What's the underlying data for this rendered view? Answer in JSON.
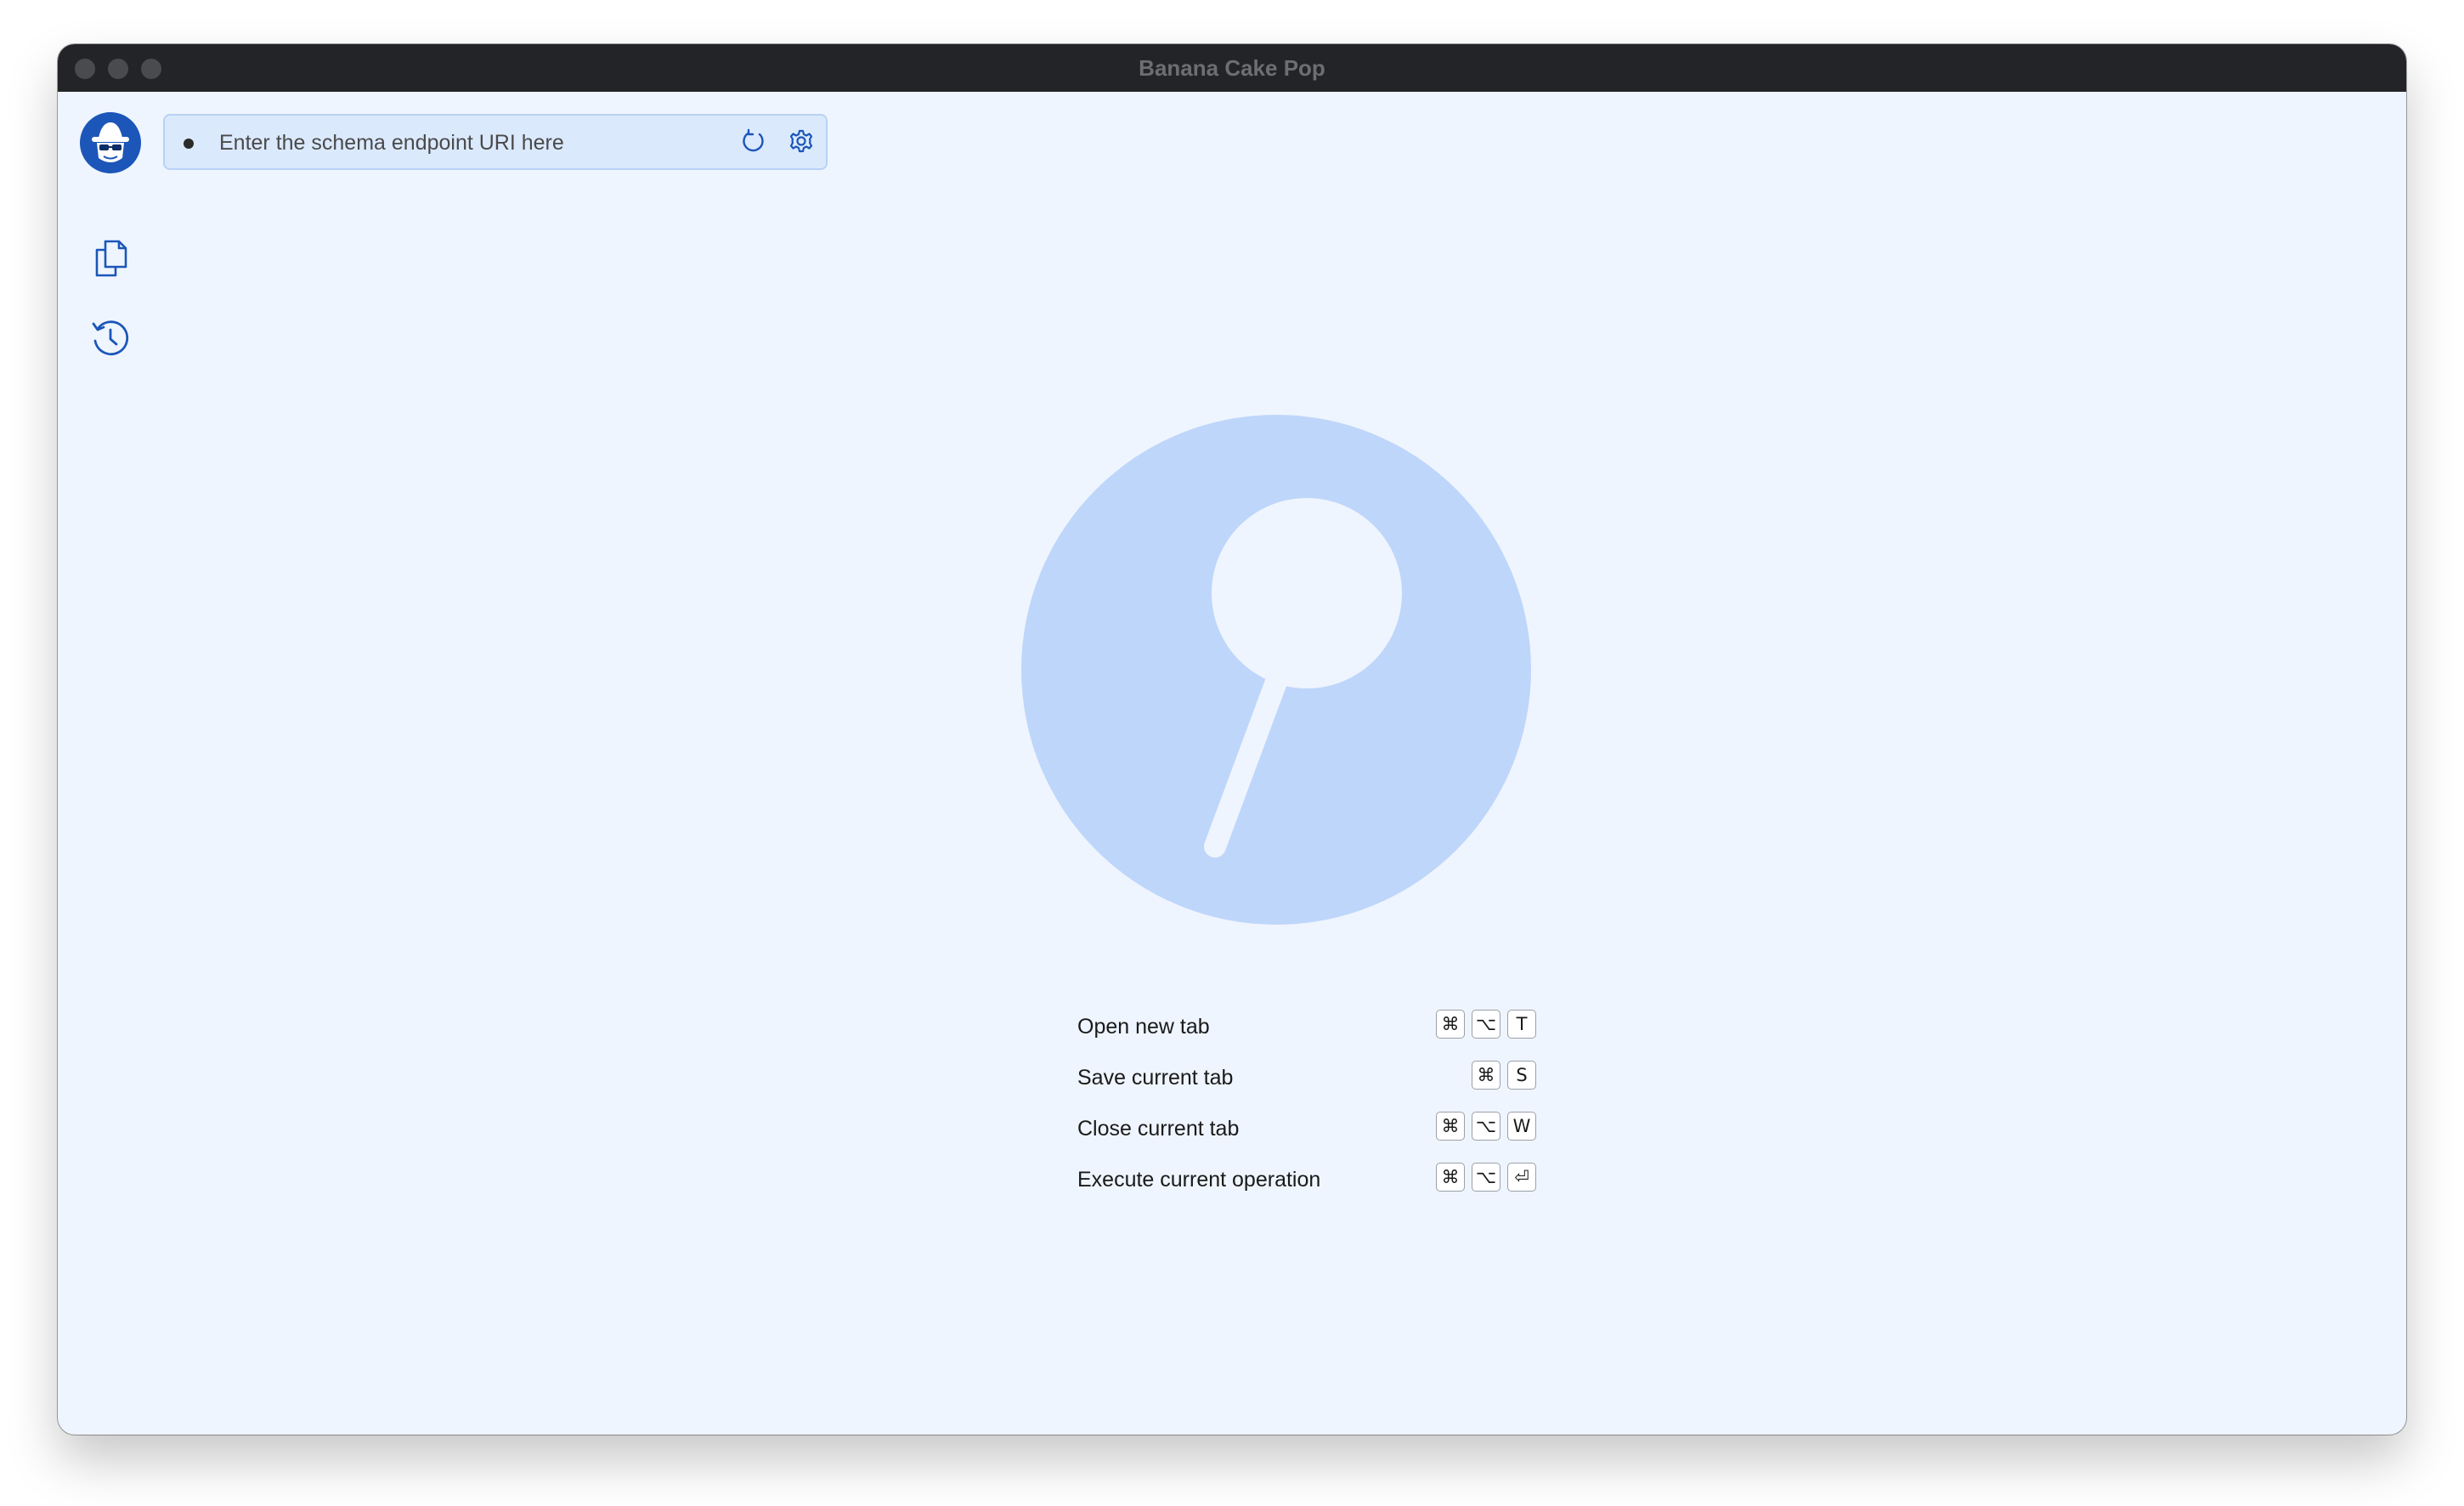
{
  "window": {
    "title": "Banana Cake Pop"
  },
  "endpoint": {
    "placeholder": "Enter the schema endpoint URI here",
    "value": ""
  },
  "sidebar": {
    "items": [
      {
        "icon": "documents-icon"
      },
      {
        "icon": "history-icon"
      }
    ]
  },
  "shortcuts": [
    {
      "label": "Open new tab",
      "keys": [
        "⌘",
        "⌥",
        "T"
      ]
    },
    {
      "label": "Save current tab",
      "keys": [
        "⌘",
        "S"
      ]
    },
    {
      "label": "Close current tab",
      "keys": [
        "⌘",
        "⌥",
        "W"
      ]
    },
    {
      "label": "Execute current operation",
      "keys": [
        "⌘",
        "⌥",
        "⏎"
      ]
    }
  ],
  "colors": {
    "accent": "#1b56b8",
    "background": "#eff5fe",
    "hero": "#bfd6fb",
    "titlebar": "#232428"
  }
}
